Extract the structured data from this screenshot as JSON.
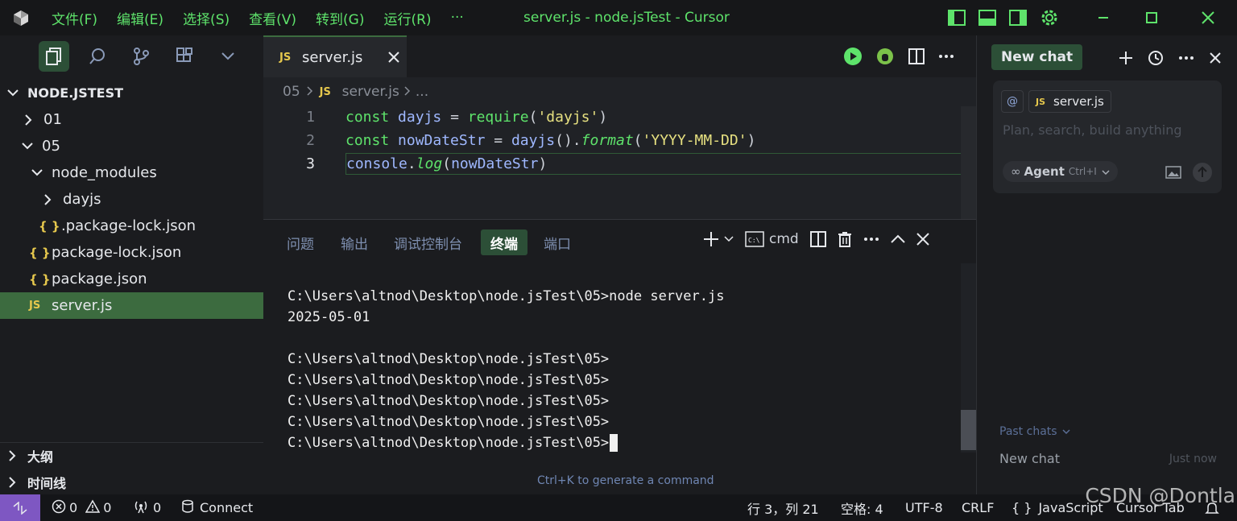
{
  "titlebar": {
    "menu": [
      "文件(F)",
      "编辑(E)",
      "选择(S)",
      "查看(V)",
      "转到(G)",
      "运行(R)",
      "···"
    ],
    "window_title": "server.js - node.jsTest - Cursor"
  },
  "explorer": {
    "title": "NODE.JSTEST",
    "items": [
      {
        "label": "01"
      },
      {
        "label": "05"
      },
      {
        "label": "node_modules"
      },
      {
        "label": "dayjs"
      },
      {
        "label": ".package-lock.json",
        "icon_text": "{ }"
      },
      {
        "label": "package-lock.json",
        "icon_text": "{ }"
      },
      {
        "label": "package.json",
        "icon_text": "{ }"
      },
      {
        "label": "server.js",
        "icon_text": "JS"
      }
    ],
    "outline_label": "大纲",
    "timeline_label": "时间线"
  },
  "editor": {
    "tab_label": "server.js",
    "tab_icon_text": "JS",
    "breadcrumb": {
      "folder": "05",
      "file": "server.js",
      "more": "..."
    },
    "lines": [
      {
        "num": "1"
      },
      {
        "num": "2"
      },
      {
        "num": "3"
      }
    ],
    "code": {
      "l1": [
        "const",
        "dayjs",
        "=",
        "require",
        "(",
        "'dayjs'",
        ")"
      ],
      "l2": [
        "const",
        "nowDateStr",
        "=",
        "dayjs",
        "().",
        "format",
        "(",
        "'YYYY-MM-DD'",
        ")"
      ],
      "l3": [
        "console",
        ".",
        "log",
        "(",
        "nowDateStr",
        ")"
      ]
    }
  },
  "panel": {
    "tabs": [
      "问题",
      "输出",
      "调试控制台",
      "终端",
      "端口"
    ],
    "active_tab": "终端",
    "shell_label": "cmd",
    "terminal_lines": [
      "C:\\Users\\altnod\\Desktop\\node.jsTest\\05>node server.js",
      "2025-05-01",
      "",
      "C:\\Users\\altnod\\Desktop\\node.jsTest\\05>",
      "C:\\Users\\altnod\\Desktop\\node.jsTest\\05>",
      "C:\\Users\\altnod\\Desktop\\node.jsTest\\05>",
      "C:\\Users\\altnod\\Desktop\\node.jsTest\\05>",
      "C:\\Users\\altnod\\Desktop\\node.jsTest\\05>"
    ],
    "generate_hint": "Ctrl+K to generate a command"
  },
  "chat": {
    "new_chat_label": "New chat",
    "context_file": "server.js",
    "context_file_icon": "JS",
    "at_symbol": "@",
    "placeholder": "Plan, search, build anything",
    "agent_label": "Agent",
    "agent_shortcut": "Ctrl+I",
    "past_chats_label": "Past chats",
    "history": [
      {
        "title": "New chat",
        "time": "Just now"
      }
    ]
  },
  "statusbar": {
    "errors": "0",
    "warnings": "0",
    "ports": "0",
    "connect": "Connect",
    "position": "行 3，列 21",
    "spaces": "空格: 4",
    "encoding": "UTF-8",
    "eol": "CRLF",
    "lang_icon": "{ }",
    "language": "JavaScript",
    "cursor_tab": "Cursor Tab"
  },
  "watermark": "CSDN @Dontla",
  "colors": {
    "accent": "#5ee36b",
    "selection": "#3c6b3f",
    "remote": "#7e57c2"
  }
}
